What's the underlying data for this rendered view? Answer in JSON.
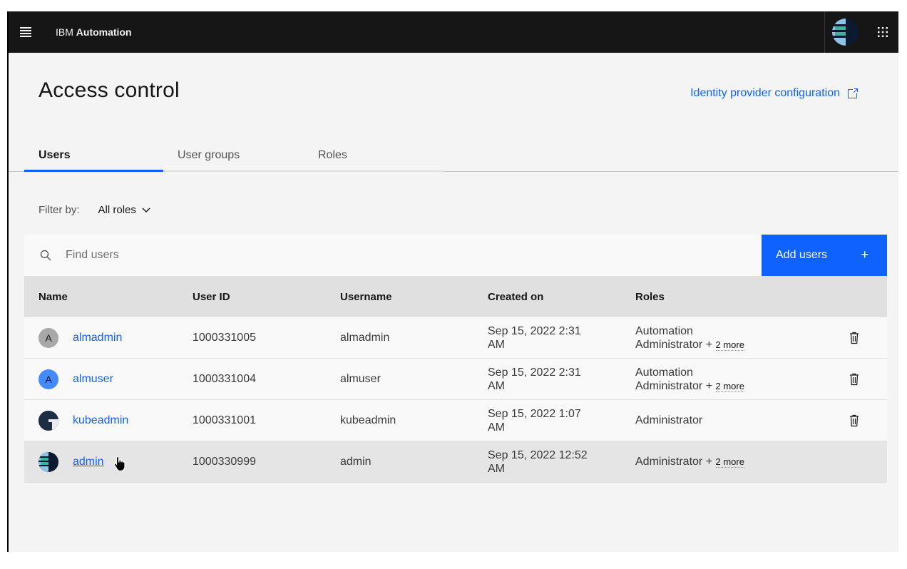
{
  "header": {
    "brand_prefix": "IBM",
    "brand_name": "Automation"
  },
  "page": {
    "title": "Access control",
    "idp_link": "Identity provider configuration"
  },
  "tabs": [
    {
      "label": "Users",
      "active": true
    },
    {
      "label": "User groups",
      "active": false
    },
    {
      "label": "Roles",
      "active": false
    }
  ],
  "filter": {
    "label": "Filter by:",
    "value": "All roles"
  },
  "search": {
    "placeholder": "Find users"
  },
  "add_button": {
    "label": "Add users",
    "icon": "+"
  },
  "table": {
    "headers": [
      "Name",
      "User ID",
      "Username",
      "Created on",
      "Roles"
    ],
    "rows": [
      {
        "avatar": "A",
        "avatar_style": "gray",
        "name": "almadmin",
        "user_id": "1000331005",
        "username": "almadmin",
        "created_line1": "Sep 15, 2022 2:31",
        "created_line2": "AM",
        "roles_line1": "Automation",
        "roles_line2": "Administrator +",
        "roles_more": "2 more",
        "deletable": true
      },
      {
        "avatar": "A",
        "avatar_style": "blue",
        "name": "almuser",
        "user_id": "1000331004",
        "username": "almuser",
        "created_line1": "Sep 15, 2022 2:31",
        "created_line2": "AM",
        "roles_line1": "Automation",
        "roles_line2": "Administrator +",
        "roles_more": "2 more",
        "deletable": true
      },
      {
        "avatar": "",
        "avatar_style": "image",
        "name": "kubeadmin",
        "user_id": "1000331001",
        "username": "kubeadmin",
        "created_line1": "Sep 15, 2022 1:07",
        "created_line2": "AM",
        "roles_line1": "Administrator",
        "roles_line2": "",
        "roles_more": "",
        "deletable": true
      },
      {
        "avatar": "",
        "avatar_style": "image",
        "name": "admin",
        "user_id": "1000330999",
        "username": "admin",
        "created_line1": "Sep 15, 2022 12:52",
        "created_line2": "AM",
        "roles_line1": "Administrator +",
        "roles_line2": "",
        "roles_more": "2 more",
        "deletable": false
      }
    ]
  },
  "colors": {
    "accent": "#0f62fe",
    "header_bg": "#161616",
    "page_bg": "#f4f4f4"
  }
}
